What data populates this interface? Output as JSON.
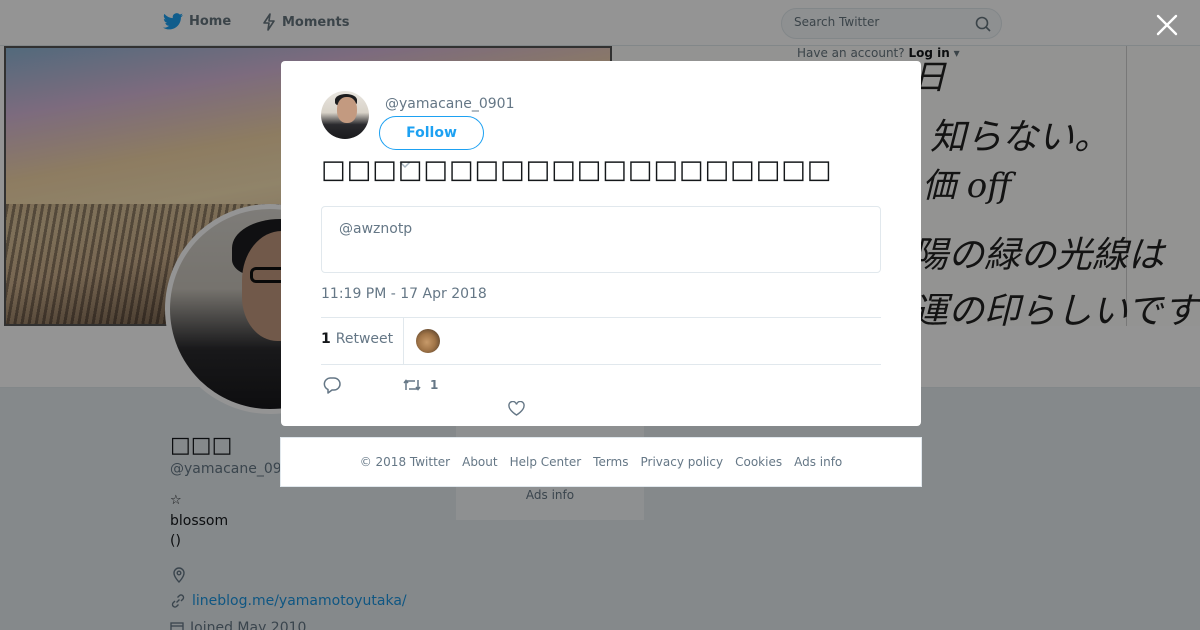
{
  "topbar": {
    "home_label": "Home",
    "moments_label": "Moments",
    "search_placeholder": "Search Twitter",
    "have_account_text": "Have an account?",
    "login_label": "Log in"
  },
  "profile": {
    "name": "□□□",
    "handle": "@yamacane_0901",
    "star": "☆",
    "bio_line1": "blossom",
    "bio_line2": "()",
    "link_text": "lineblog.me/yamamotoyutaka/",
    "joined_text": "Joined May 2010"
  },
  "side_card": {
    "ads_info": "Ads info"
  },
  "tweet": {
    "handle": "@yamacane_0901",
    "follow_label": "Follow",
    "text": "□□□□□□□□□□□□□□□□□□□□",
    "quoted_handle": "@awznotp",
    "timestamp": "11:19 PM - 17 Apr 2018",
    "retweet_count": "1",
    "retweet_label": "Retweet",
    "action_retweet_count": "1"
  },
  "footer": {
    "copyright": "© 2018 Twitter",
    "links": [
      "About",
      "Help Center",
      "Terms",
      "Privacy policy",
      "Cookies",
      "Ads info"
    ]
  },
  "colors": {
    "brand_blue": "#1da1f2",
    "text_primary": "#14171a",
    "text_secondary": "#657786",
    "overlay": "rgba(0,0,0,0.42)"
  },
  "icons": [
    "twitter-bird-icon",
    "lightning-icon",
    "search-icon",
    "close-icon",
    "caret-down-icon",
    "reply-icon",
    "retweet-icon",
    "heart-icon",
    "location-icon",
    "link-icon",
    "calendar-icon"
  ]
}
